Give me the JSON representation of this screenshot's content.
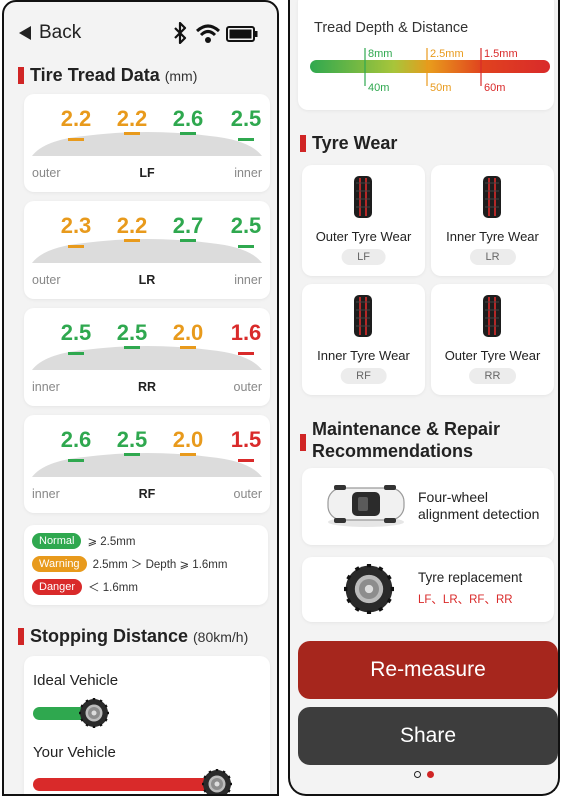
{
  "header": {
    "back_label": "Back"
  },
  "tread_section": {
    "title": "Tire Tread Data",
    "unit": "(mm)"
  },
  "tires": [
    {
      "position": "LF",
      "left_side": "outer",
      "right_side": "inner",
      "values": [
        {
          "v": "2.2",
          "level": "warning"
        },
        {
          "v": "2.2",
          "level": "warning"
        },
        {
          "v": "2.6",
          "level": "normal"
        },
        {
          "v": "2.5",
          "level": "normal"
        }
      ]
    },
    {
      "position": "LR",
      "left_side": "outer",
      "right_side": "inner",
      "values": [
        {
          "v": "2.3",
          "level": "warning"
        },
        {
          "v": "2.2",
          "level": "warning"
        },
        {
          "v": "2.7",
          "level": "normal"
        },
        {
          "v": "2.5",
          "level": "normal"
        }
      ]
    },
    {
      "position": "RR",
      "left_side": "inner",
      "right_side": "outer",
      "values": [
        {
          "v": "2.5",
          "level": "normal"
        },
        {
          "v": "2.5",
          "level": "normal"
        },
        {
          "v": "2.0",
          "level": "warning"
        },
        {
          "v": "1.6",
          "level": "danger"
        }
      ]
    },
    {
      "position": "RF",
      "left_side": "inner",
      "right_side": "outer",
      "values": [
        {
          "v": "2.6",
          "level": "normal"
        },
        {
          "v": "2.5",
          "level": "normal"
        },
        {
          "v": "2.0",
          "level": "warning"
        },
        {
          "v": "1.5",
          "level": "danger"
        }
      ]
    }
  ],
  "legend": {
    "normal_label": "Normal",
    "normal_desc": "⩾ 2.5mm",
    "warning_label": "Warning",
    "warning_desc": "2.5mm ＞ Depth ⩾ 1.6mm",
    "danger_label": "Danger",
    "danger_desc": "＜ 1.6mm"
  },
  "stopping": {
    "title": "Stopping Distance",
    "unit": "(80km/h)",
    "ideal_label": "Ideal Vehicle",
    "ideal_fraction": 0.28,
    "yours_label": "Your Vehicle",
    "yours_fraction": 0.86
  },
  "depth_distance": {
    "title": "Tread Depth & Distance",
    "depth_marks": [
      "8mm",
      "2.5mm",
      "1.5mm"
    ],
    "distance_marks": [
      "40m",
      "50m",
      "60m"
    ]
  },
  "tyre_wear": {
    "title": "Tyre Wear",
    "items": [
      {
        "label": "Outer Tyre Wear",
        "badge": "LF"
      },
      {
        "label": "Inner Tyre Wear",
        "badge": "LR"
      },
      {
        "label": "Inner Tyre Wear",
        "badge": "RF"
      },
      {
        "label": "Outer Tyre Wear",
        "badge": "RR"
      }
    ]
  },
  "maintenance": {
    "title_line1": "Maintenance & Repair",
    "title_line2": "Recommendations",
    "alignment_line1": "Four-wheel",
    "alignment_line2": "alignment detection",
    "replacement_label": "Tyre replacement",
    "replacement_targets": "LF、LR、RF、RR"
  },
  "actions": {
    "remeasure_label": "Re-measure",
    "share_label": "Share"
  },
  "pager": {
    "current": 2,
    "total": 2
  },
  "colors": {
    "normal": "#2fa84f",
    "warning": "#e89a1c",
    "danger": "#d92a2a",
    "remeasure": "#a6261d",
    "share": "#3d3d3d",
    "accent": "#d02525"
  },
  "icons": [
    "back-arrow-icon",
    "bluetooth-icon",
    "wifi-icon",
    "battery-icon",
    "tire-icon",
    "car-top-icon"
  ]
}
